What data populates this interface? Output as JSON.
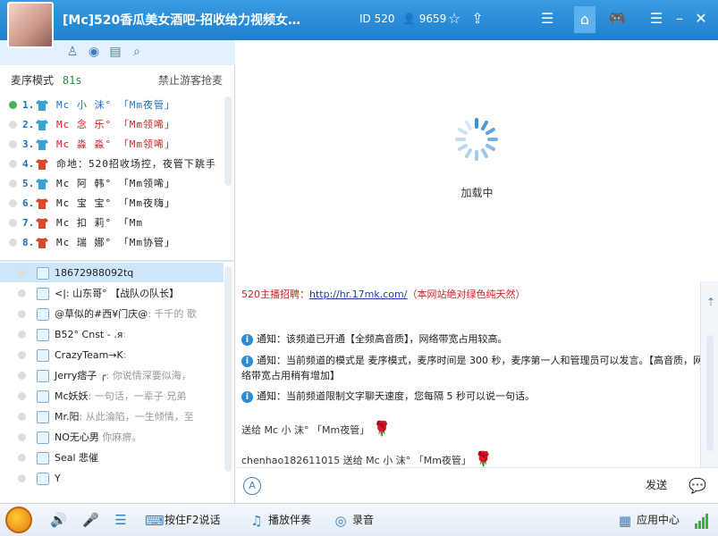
{
  "titlebar": {
    "room_title": "[Mc]520香瓜美女酒吧-招收给力视频女…",
    "room_id": "ID 520",
    "user_count": "9659",
    "accent": "#2a8ad6"
  },
  "mic_queue": {
    "mode_label": "麦序模式",
    "timer": "81s",
    "no_guest_label": "禁止游客抢麦",
    "items": [
      {
        "num": "1.",
        "name": "Mc 小 沫° 「Mm夜管」",
        "color": "#1e6fbf",
        "active": true
      },
      {
        "num": "2.",
        "name": "Mc 念 乐° 「Mm领唏」",
        "color": "#d81e1e",
        "active": false
      },
      {
        "num": "3.",
        "name": "Mc 淼 淼° 「Mm领唏」",
        "color": "#d81e1e",
        "active": false
      },
      {
        "num": "4.",
        "name": "命地：520招收场控，夜管下跳手",
        "color": "#222222",
        "active": false
      },
      {
        "num": "5.",
        "name": "Mc 阿 韩° 「Mm领唏」",
        "color": "#222222",
        "active": false
      },
      {
        "num": "6.",
        "name": "Mc 宝 宝° 「Mm夜嗨」",
        "color": "#222222",
        "active": false
      },
      {
        "num": "7.",
        "name": "Mc 扣 莉° 「Mm",
        "color": "#222222",
        "active": false
      },
      {
        "num": "8.",
        "name": "Mc 瑞 娜° 「Mm协管」",
        "color": "#222222",
        "active": false
      }
    ]
  },
  "users": [
    {
      "name": "18672988092tq",
      "sub": ""
    },
    {
      "name": "<|: 山东哥° 【战队の队长】",
      "sub": ""
    },
    {
      "name": "@草似的#西¥门庆@",
      "sub": ": 千千的 歌"
    },
    {
      "name": "B52° Cnst - .я",
      "sub": ":"
    },
    {
      "name": "CrazyTeam→K",
      "sub": ":"
    },
    {
      "name": "Jerry痞子 ╭",
      "sub": ": 你说情深要似海，"
    },
    {
      "name": "Mc妖妖",
      "sub": ": 一句话，一辈子 兄弟"
    },
    {
      "name": "Mr.阳",
      "sub": ": 从此淪陷，一生倾情，至"
    },
    {
      "name": "NO无心男",
      "sub": " 你麻痹。"
    },
    {
      "name": "Seal 悲催",
      "sub": ""
    },
    {
      "name": "Y",
      "sub": ""
    }
  ],
  "video": {
    "loading_text": "加载中"
  },
  "chat": {
    "recruit_prefix": "520主播招聘：",
    "recruit_link": "http://hr.17mk.com/",
    "recruit_suffix": "（本网站绝对绿色纯天然）",
    "notice1": "通知：该频道已开通【全频高音质】，网络带宽占用较高。",
    "notice2": "通知：当前频道的模式是 麦序模式，麦序时间是 300 秒，麦序第一人和管理员可以发言。【高音质，网络带宽占用稍有增加】",
    "notice3": "通知：当前频道限制文字聊天速度，您每隔 5 秒可以说一句话。",
    "gift1": "送给 Mc 小 沫° 「Mm夜管」",
    "gift2": "chenhao182611015 送给 Mc 小 沫° 「Mm夜管」"
  },
  "input": {
    "send_label": "发送"
  },
  "bottombar": {
    "f2_label": "按住F2说话",
    "music_label": "播放伴奏",
    "record_label": "录音",
    "apps_label": "应用中心"
  }
}
